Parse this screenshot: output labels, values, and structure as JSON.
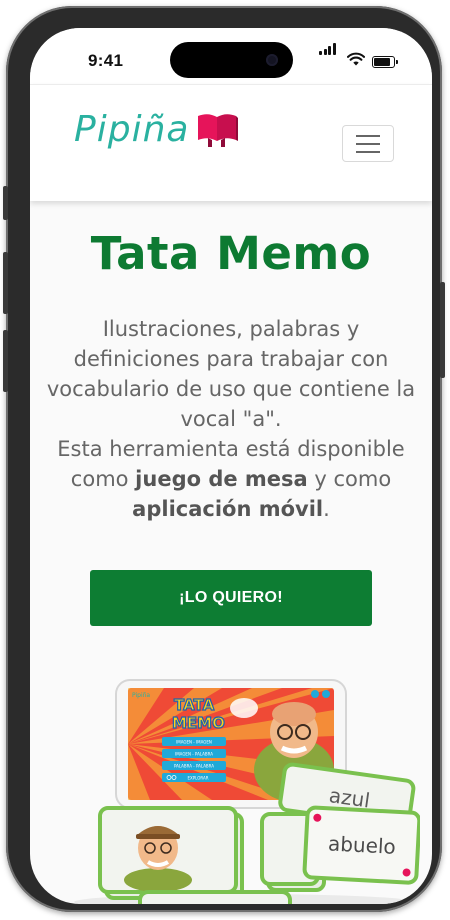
{
  "status_bar": {
    "time": "9:41"
  },
  "brand": {
    "name": "Pipiña",
    "color": "#2ab1a0",
    "book_color": "#e6145a"
  },
  "header": {
    "menu_icon": "hamburger-menu-icon"
  },
  "main": {
    "title": "Tata Memo",
    "description": {
      "part1": "Ilustraciones, palabras y definiciones para trabajar con vocabulario de uso que contiene la vocal \"a\".",
      "part2": "Esta herramienta está disponible como ",
      "bold1": "juego de mesa",
      "part3": " y como ",
      "bold2": "aplicación móvil",
      "part4": "."
    },
    "cta_label": "¡LO QUIERO!",
    "accent_color": "#0d7d33"
  },
  "product_image": {
    "app_logo": "Pipiña",
    "app_title_line1": "TATA",
    "app_title_line2": "MEMO",
    "menu_items": [
      "IMAGEN - IMAGEN",
      "IMAGEN - PALABRA",
      "PALABRA - PALABRA",
      "EXPLORAR"
    ],
    "card_word_1": "azul",
    "card_word_2": "abuelo"
  }
}
